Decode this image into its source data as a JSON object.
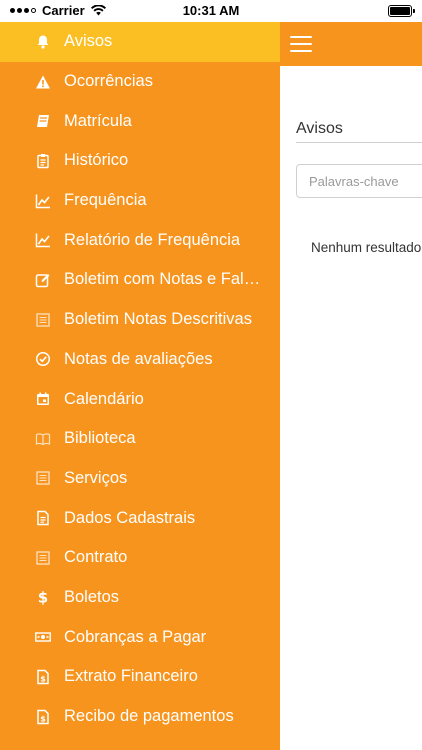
{
  "status": {
    "carrier": "Carrier",
    "time": "10:31 AM"
  },
  "sidebar": {
    "items": [
      {
        "label": "Avisos",
        "icon": "bell-icon",
        "active": true
      },
      {
        "label": "Ocorrências",
        "icon": "warning-icon"
      },
      {
        "label": "Matrícula",
        "icon": "book-icon"
      },
      {
        "label": "Histórico",
        "icon": "clipboard-icon"
      },
      {
        "label": "Frequência",
        "icon": "line-chart-icon"
      },
      {
        "label": "Relatório de Frequência",
        "icon": "line-chart-icon"
      },
      {
        "label": "Boletim com Notas e Faltas",
        "icon": "edit-icon"
      },
      {
        "label": "Boletim Notas Descritivas",
        "icon": "list-icon"
      },
      {
        "label": "Notas de avaliações",
        "icon": "check-circle-icon"
      },
      {
        "label": "Calendário",
        "icon": "calendar-icon"
      },
      {
        "label": "Biblioteca",
        "icon": "open-book-icon"
      },
      {
        "label": "Serviços",
        "icon": "list-icon"
      },
      {
        "label": "Dados Cadastrais",
        "icon": "document-icon"
      },
      {
        "label": "Contrato",
        "icon": "list-icon"
      },
      {
        "label": "Boletos",
        "icon": "dollar-icon"
      },
      {
        "label": "Cobranças a Pagar",
        "icon": "money-icon"
      },
      {
        "label": "Extrato Financeiro",
        "icon": "receipt-icon"
      },
      {
        "label": "Recibo de pagamentos",
        "icon": "receipt-icon"
      }
    ]
  },
  "main": {
    "title": "Avisos",
    "search_placeholder": "Palavras-chave",
    "empty_message": "Nenhum resultado"
  },
  "colors": {
    "accent": "#f7941e",
    "active_item": "#fbbf24"
  }
}
